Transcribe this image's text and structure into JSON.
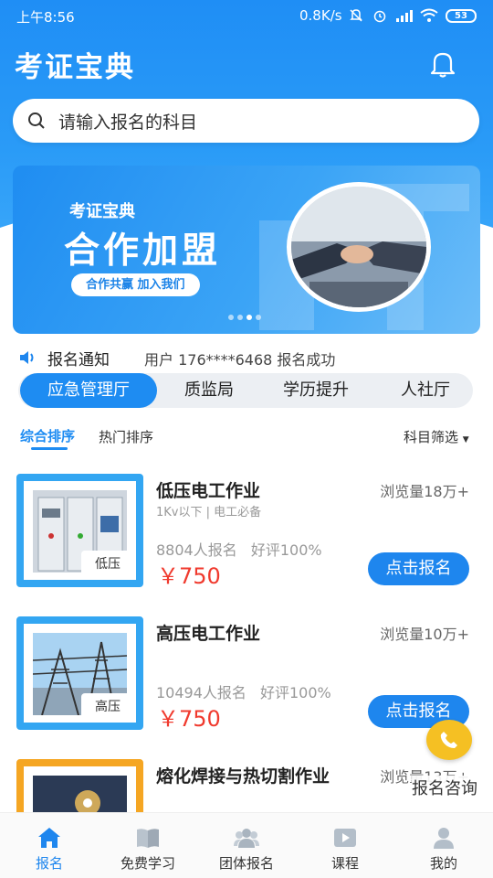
{
  "status_bar": {
    "time": "上午8:56",
    "network": "0.8K/s",
    "battery": "53"
  },
  "app": {
    "title": "考证宝典"
  },
  "search": {
    "placeholder": "请输入报名的科目"
  },
  "banner": {
    "subtitle": "考证宝典",
    "headline": "合作加盟",
    "tagline": "合作共赢  加入我们",
    "slides": 4,
    "active_slide": 3
  },
  "notice": {
    "label": "报名通知",
    "message": "用户 176****6468  报名成功"
  },
  "category_tabs": [
    {
      "label": "应急管理厅",
      "active": true
    },
    {
      "label": "质监局",
      "active": false
    },
    {
      "label": "学历提升",
      "active": false
    },
    {
      "label": "人社厅",
      "active": false
    }
  ],
  "sort": {
    "comprehensive": "综合排序",
    "popular": "热门排序",
    "filter": "科目筛选"
  },
  "courses": [
    {
      "title": "低压电工作业",
      "views": "浏览量18万+",
      "subtitle": "1Kv以下 | 电工必备",
      "enrolled": "8804人报名",
      "rating": "好评100%",
      "price": "￥750",
      "tag": "低压",
      "button": "点击报名"
    },
    {
      "title": "高压电工作业",
      "views": "浏览量10万+",
      "subtitle": "",
      "enrolled": "10494人报名",
      "rating": "好评100%",
      "price": "￥750",
      "tag": "高压",
      "button": "点击报名"
    },
    {
      "title": "熔化焊接与热切割作业",
      "views": "浏览量13万+",
      "subtitle": "",
      "enrolled": "",
      "rating": "",
      "price": "",
      "tag": "",
      "button": ""
    }
  ],
  "consult": {
    "label": "报名咨询"
  },
  "tabbar": [
    {
      "label": "报名",
      "icon": "home-icon",
      "active": true
    },
    {
      "label": "免费学习",
      "icon": "book-icon",
      "active": false
    },
    {
      "label": "团体报名",
      "icon": "group-icon",
      "active": false
    },
    {
      "label": "课程",
      "icon": "play-icon",
      "active": false
    },
    {
      "label": "我的",
      "icon": "user-icon",
      "active": false
    }
  ],
  "colors": {
    "primary": "#1e86ee",
    "price": "#f03a2e",
    "fab": "#f5c023"
  }
}
